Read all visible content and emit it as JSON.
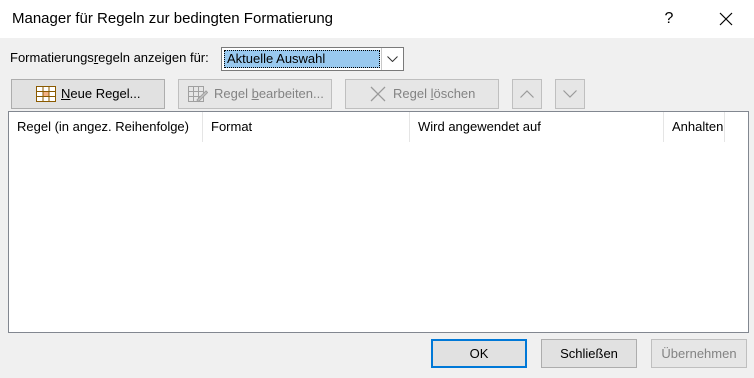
{
  "window": {
    "title": "Manager für Regeln zur bedingten Formatierung",
    "help_label": "?",
    "close_icon": "close-icon"
  },
  "filter": {
    "label_prefix": "Formatierungs",
    "label_access": "r",
    "label_suffix": "egeln anzeigen für:",
    "selected_value": "Aktuelle Auswahl"
  },
  "toolbar": {
    "new_rule": {
      "access": "N",
      "rest": "eue Regel...",
      "enabled": true,
      "icon": "new-rule-icon"
    },
    "edit_rule": {
      "prefix": "Regel ",
      "access": "b",
      "rest": "earbeiten...",
      "enabled": false,
      "icon": "edit-rule-icon"
    },
    "delete_rule": {
      "prefix": "Regel ",
      "access": "l",
      "rest": "öschen",
      "enabled": false,
      "icon": "delete-x-icon"
    },
    "move_up": {
      "enabled": false,
      "icon": "chevron-up-icon"
    },
    "move_down": {
      "enabled": false,
      "icon": "chevron-down-icon"
    }
  },
  "table": {
    "columns": [
      "Regel (in angez. Reihenfolge)",
      "Format",
      "Wird angewendet auf",
      "Anhalten"
    ],
    "rows": []
  },
  "footer": {
    "ok": "OK",
    "close": "Schließen",
    "apply": "Übernehmen"
  },
  "colors": {
    "accent": "#0078d7",
    "selection": "#99c9ef",
    "dialog_bg": "#f0f0f0"
  }
}
